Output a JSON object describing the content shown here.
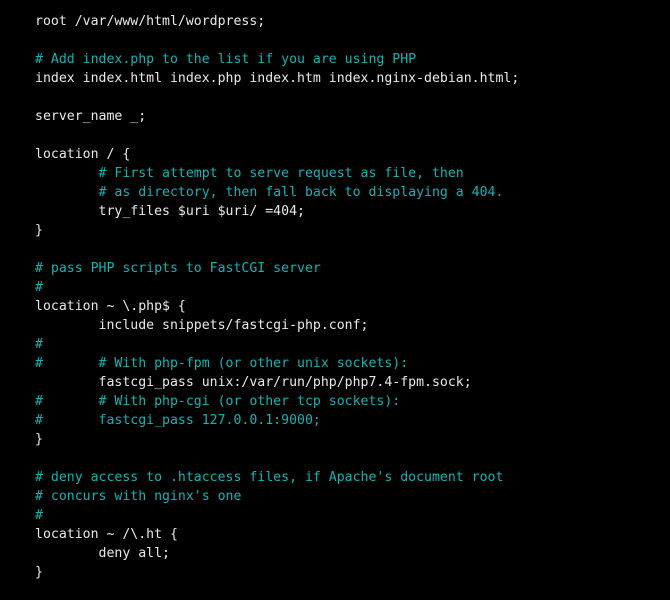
{
  "terminal": {
    "background_color": "#000000",
    "code_color": "#e9e9e9",
    "comment_color": "#12b4b4",
    "file_type": "nginx-config",
    "lines": [
      {
        "text": "root /var/www/html/wordpress;",
        "kind": "code"
      },
      {
        "text": "",
        "kind": "blank"
      },
      {
        "text": "# Add index.php to the list if you are using PHP",
        "kind": "comment"
      },
      {
        "text": "index index.html index.php index.htm index.nginx-debian.html;",
        "kind": "code"
      },
      {
        "text": "",
        "kind": "blank"
      },
      {
        "text": "server_name _;",
        "kind": "code"
      },
      {
        "text": "",
        "kind": "blank"
      },
      {
        "text": "location / {",
        "kind": "code"
      },
      {
        "text": "        # First attempt to serve request as file, then",
        "kind": "comment"
      },
      {
        "text": "        # as directory, then fall back to displaying a 404.",
        "kind": "comment"
      },
      {
        "text": "        try_files $uri $uri/ =404;",
        "kind": "code"
      },
      {
        "text": "}",
        "kind": "code"
      },
      {
        "text": "",
        "kind": "blank"
      },
      {
        "text": "# pass PHP scripts to FastCGI server",
        "kind": "comment"
      },
      {
        "text": "#",
        "kind": "comment"
      },
      {
        "text": "location ~ \\.php$ {",
        "kind": "code"
      },
      {
        "text": "        include snippets/fastcgi-php.conf;",
        "kind": "code"
      },
      {
        "text": "#",
        "kind": "comment"
      },
      {
        "text": "#       # With php-fpm (or other unix sockets):",
        "kind": "comment"
      },
      {
        "text": "        fastcgi_pass unix:/var/run/php/php7.4-fpm.sock;",
        "kind": "code"
      },
      {
        "text": "#       # With php-cgi (or other tcp sockets):",
        "kind": "comment"
      },
      {
        "text": "#       fastcgi_pass 127.0.0.1:9000;",
        "kind": "comment"
      },
      {
        "text": "}",
        "kind": "code"
      },
      {
        "text": "",
        "kind": "blank"
      },
      {
        "text": "# deny access to .htaccess files, if Apache's document root",
        "kind": "comment"
      },
      {
        "text": "# concurs with nginx's one",
        "kind": "comment"
      },
      {
        "text": "#",
        "kind": "comment"
      },
      {
        "text": "location ~ /\\.ht {",
        "kind": "code"
      },
      {
        "text": "        deny all;",
        "kind": "code"
      },
      {
        "text": "}",
        "kind": "code"
      }
    ]
  }
}
